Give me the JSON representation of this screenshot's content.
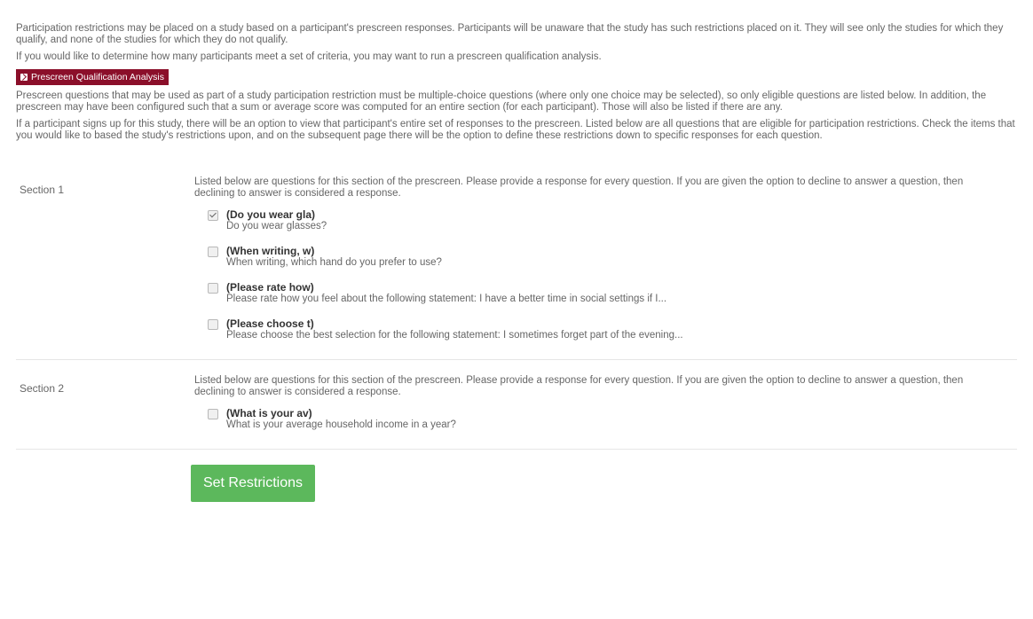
{
  "intro": {
    "paragraph1": "Participation restrictions may be placed on a study based on a participant's prescreen responses. Participants will be unaware that the study has such restrictions placed on it. They will see only the studies for which they qualify, and none of the studies for which they do not qualify.",
    "paragraph2": "If you would like to determine how many participants meet a set of criteria, you may want to run a prescreen qualification analysis.",
    "analysis_button_label": "Prescreen Qualification Analysis",
    "paragraph3": "Prescreen questions that may be used as part of a study participation restriction must be multiple-choice questions (where only one choice may be selected), so only eligible questions are listed below. In addition, the prescreen may have been configured such that a sum or average score was computed for an entire section (for each participant). Those will also be listed if there are any.",
    "paragraph4": "If a participant signs up for this study, there will be an option to view that participant's entire set of responses to the prescreen. Listed below are all questions that are eligible for participation restrictions. Check the items that you would like to based the study's restrictions upon, and on the subsequent page there will be the option to define these restrictions down to specific responses for each question."
  },
  "sections": [
    {
      "label": "Section 1",
      "description": "Listed below are questions for this section of the prescreen. Please provide a response for every question. If you are given the option to decline to answer a question, then declining to answer is considered a response.",
      "questions": [
        {
          "code": "(Do you wear gla)",
          "text": "Do you wear glasses?",
          "checked": true
        },
        {
          "code": "(When writing, w)",
          "text": "When writing, which hand do you prefer to use?",
          "checked": false
        },
        {
          "code": "(Please rate how)",
          "text": "Please rate how you feel about the following statement: I have a better time in social settings if I...",
          "checked": false
        },
        {
          "code": "(Please choose t)",
          "text": "Please choose the best selection for the following statement: I sometimes forget part of the evening...",
          "checked": false
        }
      ]
    },
    {
      "label": "Section 2",
      "description": "Listed below are questions for this section of the prescreen. Please provide a response for every question. If you are given the option to decline to answer a question, then declining to answer is considered a response.",
      "questions": [
        {
          "code": "(What is your av)",
          "text": "What is your average household income in a year?",
          "checked": false
        }
      ]
    }
  ],
  "submit_label": "Set Restrictions",
  "colors": {
    "analysis_button_bg": "#8b0f2a",
    "submit_button_bg": "#5cb85c"
  }
}
